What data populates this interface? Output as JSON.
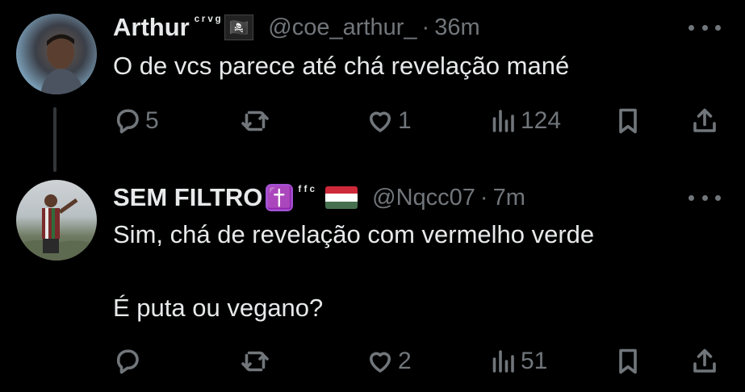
{
  "tweets": [
    {
      "name": "Arthur",
      "name_deco": "ᶜʳᵛᵍ",
      "badge_emoji": "🏴‍☠️",
      "handle": "@coe_arthur_",
      "separator": "·",
      "time": "36m",
      "text": "O de vcs parece até chá revelação mané",
      "replies": "5",
      "retweets": "",
      "likes": "1",
      "views": "124"
    },
    {
      "name": "SEM FILTRO",
      "badge_emoji": "✝️",
      "name_deco": "ᶠᶠᶜ",
      "flag": "🇭🇺",
      "handle": "@Nqcc07",
      "separator": "·",
      "time": "7m",
      "text_line1": "Sim, chá de revelação com vermelho verde",
      "text_line2": "É puta ou vegano?",
      "replies": "",
      "retweets": "",
      "likes": "2",
      "views": "51"
    }
  ],
  "colors": {
    "background": "#000000",
    "text": "#e7e9ea",
    "muted": "#71767b",
    "thread_line": "#333639"
  },
  "icons": [
    "reply-icon",
    "retweet-icon",
    "like-icon",
    "views-icon",
    "bookmark-icon",
    "share-icon",
    "more-icon"
  ]
}
